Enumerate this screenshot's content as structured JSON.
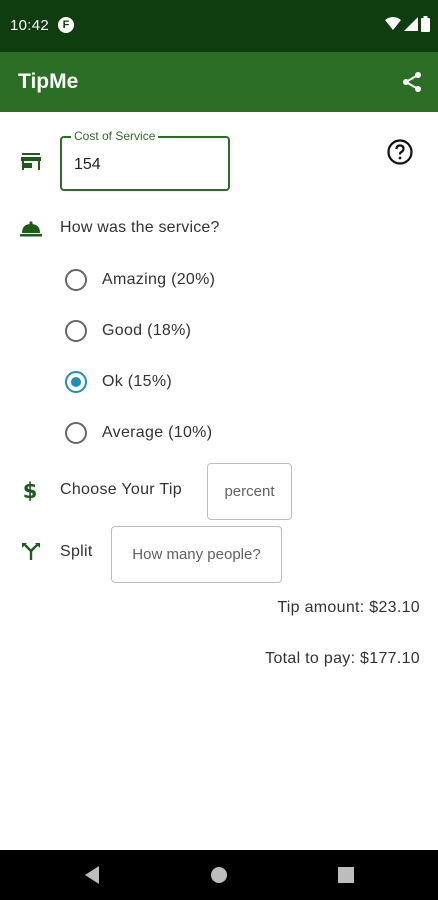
{
  "status_bar": {
    "time": "10:42",
    "notification_badge": "F",
    "icons": [
      "wifi-icon",
      "signal-icon",
      "battery-icon"
    ]
  },
  "app_bar": {
    "title": "TipMe",
    "share_icon": "share-icon"
  },
  "cost_field": {
    "label": "Cost of Service",
    "value": "154",
    "icon": "store-icon"
  },
  "help_icon": "help-icon",
  "service": {
    "question": "How was the service?",
    "icon": "service-bell-icon",
    "options": [
      {
        "label": "Amazing (20%)",
        "checked": false
      },
      {
        "label": "Good (18%)",
        "checked": false
      },
      {
        "label": "Ok (15%)",
        "checked": true
      },
      {
        "label": "Average (10%)",
        "checked": false
      }
    ]
  },
  "custom_tip": {
    "label": "Choose Your Tip",
    "placeholder": "percent",
    "icon": "dollar-icon"
  },
  "split": {
    "label": "Split",
    "placeholder": "How many people?",
    "icon": "split-icon"
  },
  "summary": {
    "tip_amount": "Tip amount: $23.10",
    "total": "Total to pay: $177.10"
  },
  "nav": [
    "back-icon",
    "home-icon",
    "recents-icon"
  ],
  "colors": {
    "status_bar": "#0f3d0f",
    "app_bar": "#2d6e27",
    "accent": "#1e8fb8",
    "icon_green": "#1e5c1a"
  }
}
